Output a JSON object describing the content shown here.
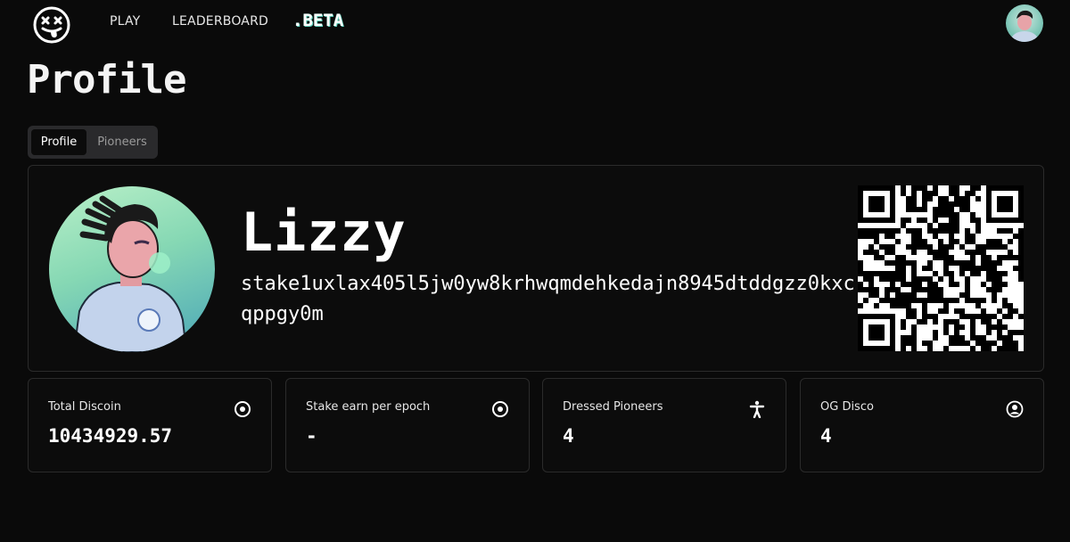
{
  "nav": {
    "links": [
      "PLAY",
      "LEADERBOARD"
    ],
    "beta_label": ".BETA"
  },
  "page": {
    "title": "Profile"
  },
  "tabs": [
    {
      "label": "Profile",
      "active": true
    },
    {
      "label": "Pioneers",
      "active": false
    }
  ],
  "profile": {
    "username": "Lizzy",
    "stake_address": "stake1uxlax405l5jw0yw8krhwqmdehkedajn8945dtddgzz0kxcqppgy0m"
  },
  "stats": [
    {
      "label": "Total Discoin",
      "value": "10434929.57",
      "icon": "target-icon"
    },
    {
      "label": "Stake earn per epoch",
      "value": "-",
      "icon": "target-icon"
    },
    {
      "label": "Dressed Pioneers",
      "value": "4",
      "icon": "person-icon"
    },
    {
      "label": "OG Disco",
      "value": "4",
      "icon": "user-circle-icon"
    }
  ],
  "colors": {
    "background": "#0a0a0a",
    "card_border": "#2b2b2b",
    "tab_bg": "#2a2a2c",
    "beta_accent": "#5fd4c0"
  }
}
